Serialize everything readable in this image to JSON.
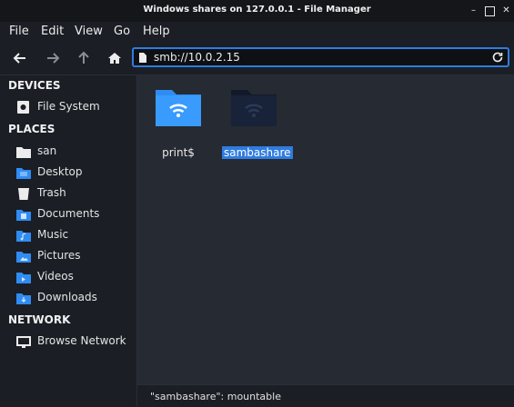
{
  "window": {
    "title": "Windows shares on 127.0.0.1 - File Manager",
    "minimize": "–",
    "close": "✕"
  },
  "menu": [
    "File",
    "Edit",
    "View",
    "Go",
    "Help"
  ],
  "location": {
    "value": "smb://10.0.2.15"
  },
  "sidebar": {
    "devices_title": "DEVICES",
    "devices": [
      {
        "label": "File System",
        "icon": "drive-icon"
      }
    ],
    "places_title": "PLACES",
    "places": [
      {
        "label": "san",
        "icon": "home-folder-icon"
      },
      {
        "label": "Desktop",
        "icon": "desktop-folder-icon"
      },
      {
        "label": "Trash",
        "icon": "trash-icon"
      },
      {
        "label": "Documents",
        "icon": "documents-folder-icon"
      },
      {
        "label": "Music",
        "icon": "music-folder-icon"
      },
      {
        "label": "Pictures",
        "icon": "pictures-folder-icon"
      },
      {
        "label": "Videos",
        "icon": "videos-folder-icon"
      },
      {
        "label": "Downloads",
        "icon": "downloads-folder-icon"
      }
    ],
    "network_title": "NETWORK",
    "network": [
      {
        "label": "Browse Network",
        "icon": "network-icon"
      }
    ]
  },
  "files": [
    {
      "name": "print$",
      "icon": "network-share-folder-icon",
      "selected": false
    },
    {
      "name": "sambashare",
      "icon": "network-share-folder-icon",
      "selected": true
    }
  ],
  "status": {
    "text": "\"sambashare\": mountable"
  },
  "colors": {
    "accent": "#2f7ce0",
    "folder": "#2f8cf2",
    "folder_dark": "#182238"
  }
}
